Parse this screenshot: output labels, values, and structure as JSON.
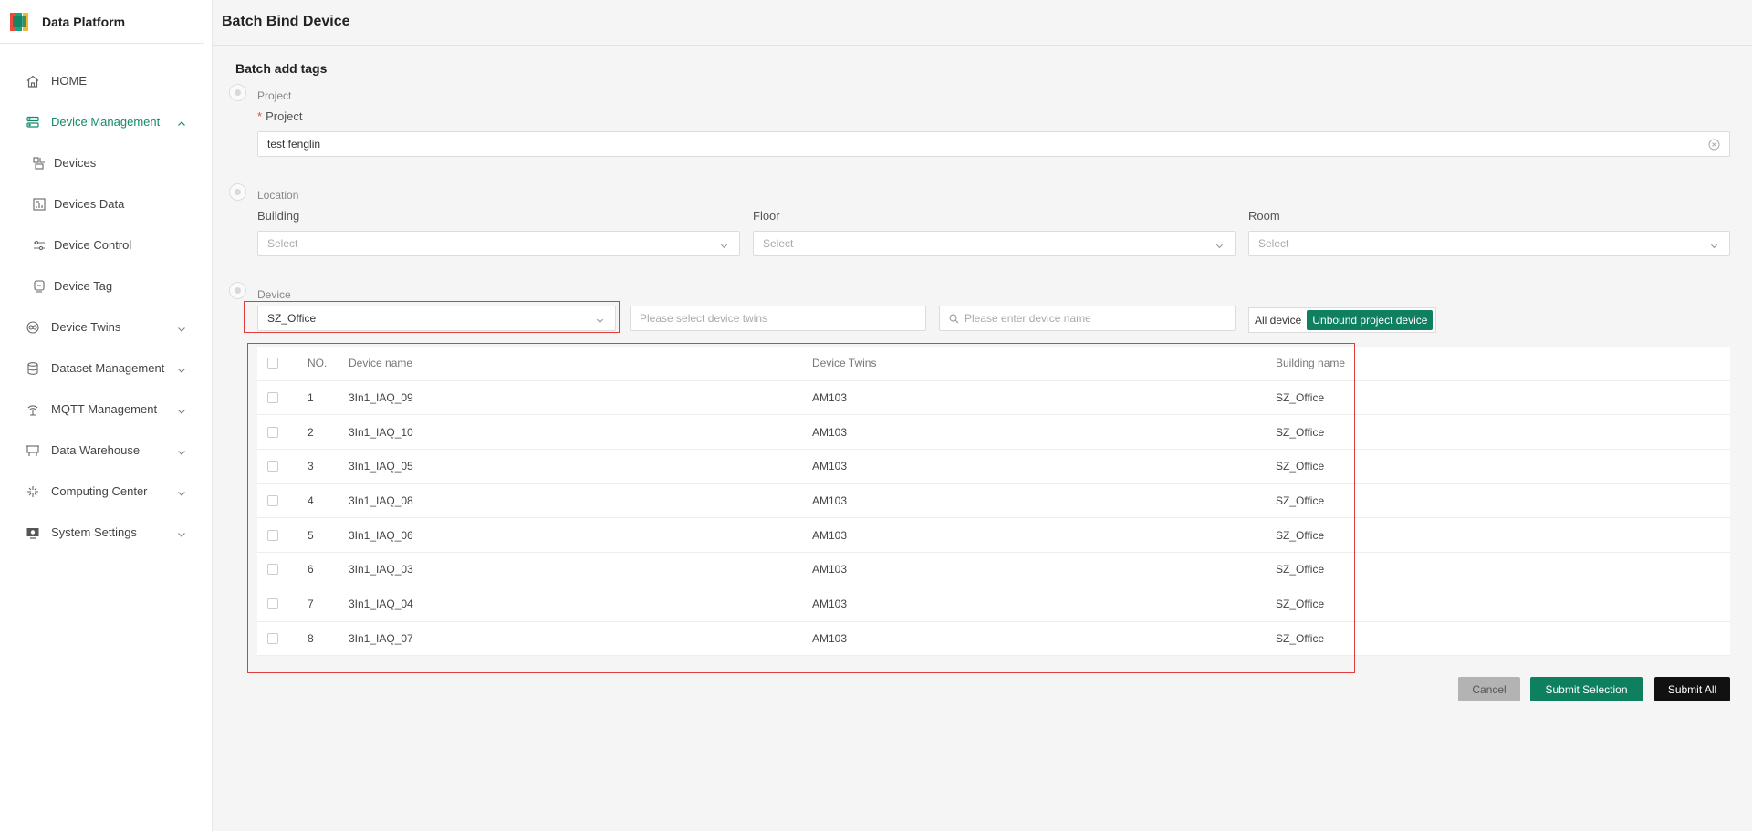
{
  "app": {
    "title": "Data Platform"
  },
  "sidebar": {
    "items": [
      {
        "label": "HOME",
        "icon": "home-icon"
      },
      {
        "label": "Device Management",
        "icon": "device-management-icon",
        "active": true,
        "expanded": true,
        "children": [
          {
            "label": "Devices",
            "icon": "devices-icon"
          },
          {
            "label": "Devices Data",
            "icon": "devices-data-icon"
          },
          {
            "label": "Device Control",
            "icon": "device-control-icon"
          },
          {
            "label": "Device Tag",
            "icon": "device-tag-icon"
          }
        ]
      },
      {
        "label": "Device Twins",
        "icon": "device-twins-icon"
      },
      {
        "label": "Dataset Management",
        "icon": "dataset-icon"
      },
      {
        "label": "MQTT Management",
        "icon": "mqtt-icon"
      },
      {
        "label": "Data Warehouse",
        "icon": "warehouse-icon"
      },
      {
        "label": "Computing Center",
        "icon": "computing-icon"
      },
      {
        "label": "System Settings",
        "icon": "settings-icon"
      }
    ]
  },
  "header": {
    "title": "Batch Bind Device"
  },
  "form": {
    "section_title": "Batch add tags",
    "project": {
      "step": "Project",
      "label": "Project",
      "required_mark": "*",
      "value": "test fenglin"
    },
    "location": {
      "step": "Location",
      "building": {
        "label": "Building",
        "placeholder": "Select"
      },
      "floor": {
        "label": "Floor",
        "placeholder": "Select"
      },
      "room": {
        "label": "Room",
        "placeholder": "Select"
      }
    },
    "device": {
      "step": "Device",
      "building_select": "SZ_Office",
      "twins_placeholder": "Please select device twins",
      "name_placeholder": "Please enter device name",
      "toggle": {
        "all": "All device",
        "unbound": "Unbound project device",
        "selected": "unbound"
      }
    }
  },
  "table": {
    "headers": {
      "no": "NO.",
      "name": "Device name",
      "twins": "Device Twins",
      "building": "Building name"
    },
    "rows": [
      {
        "no": "1",
        "name": "3In1_IAQ_09",
        "twins": "AM103",
        "building": "SZ_Office"
      },
      {
        "no": "2",
        "name": "3In1_IAQ_10",
        "twins": "AM103",
        "building": "SZ_Office"
      },
      {
        "no": "3",
        "name": "3In1_IAQ_05",
        "twins": "AM103",
        "building": "SZ_Office"
      },
      {
        "no": "4",
        "name": "3In1_IAQ_08",
        "twins": "AM103",
        "building": "SZ_Office"
      },
      {
        "no": "5",
        "name": "3In1_IAQ_06",
        "twins": "AM103",
        "building": "SZ_Office"
      },
      {
        "no": "6",
        "name": "3In1_IAQ_03",
        "twins": "AM103",
        "building": "SZ_Office"
      },
      {
        "no": "7",
        "name": "3In1_IAQ_04",
        "twins": "AM103",
        "building": "SZ_Office"
      },
      {
        "no": "8",
        "name": "3In1_IAQ_07",
        "twins": "AM103",
        "building": "SZ_Office"
      }
    ]
  },
  "actions": {
    "cancel": "Cancel",
    "submit_selection": "Submit Selection",
    "submit_all": "Submit All"
  },
  "colors": {
    "accent": "#0e7f5f",
    "highlight": "#e23b3b"
  }
}
